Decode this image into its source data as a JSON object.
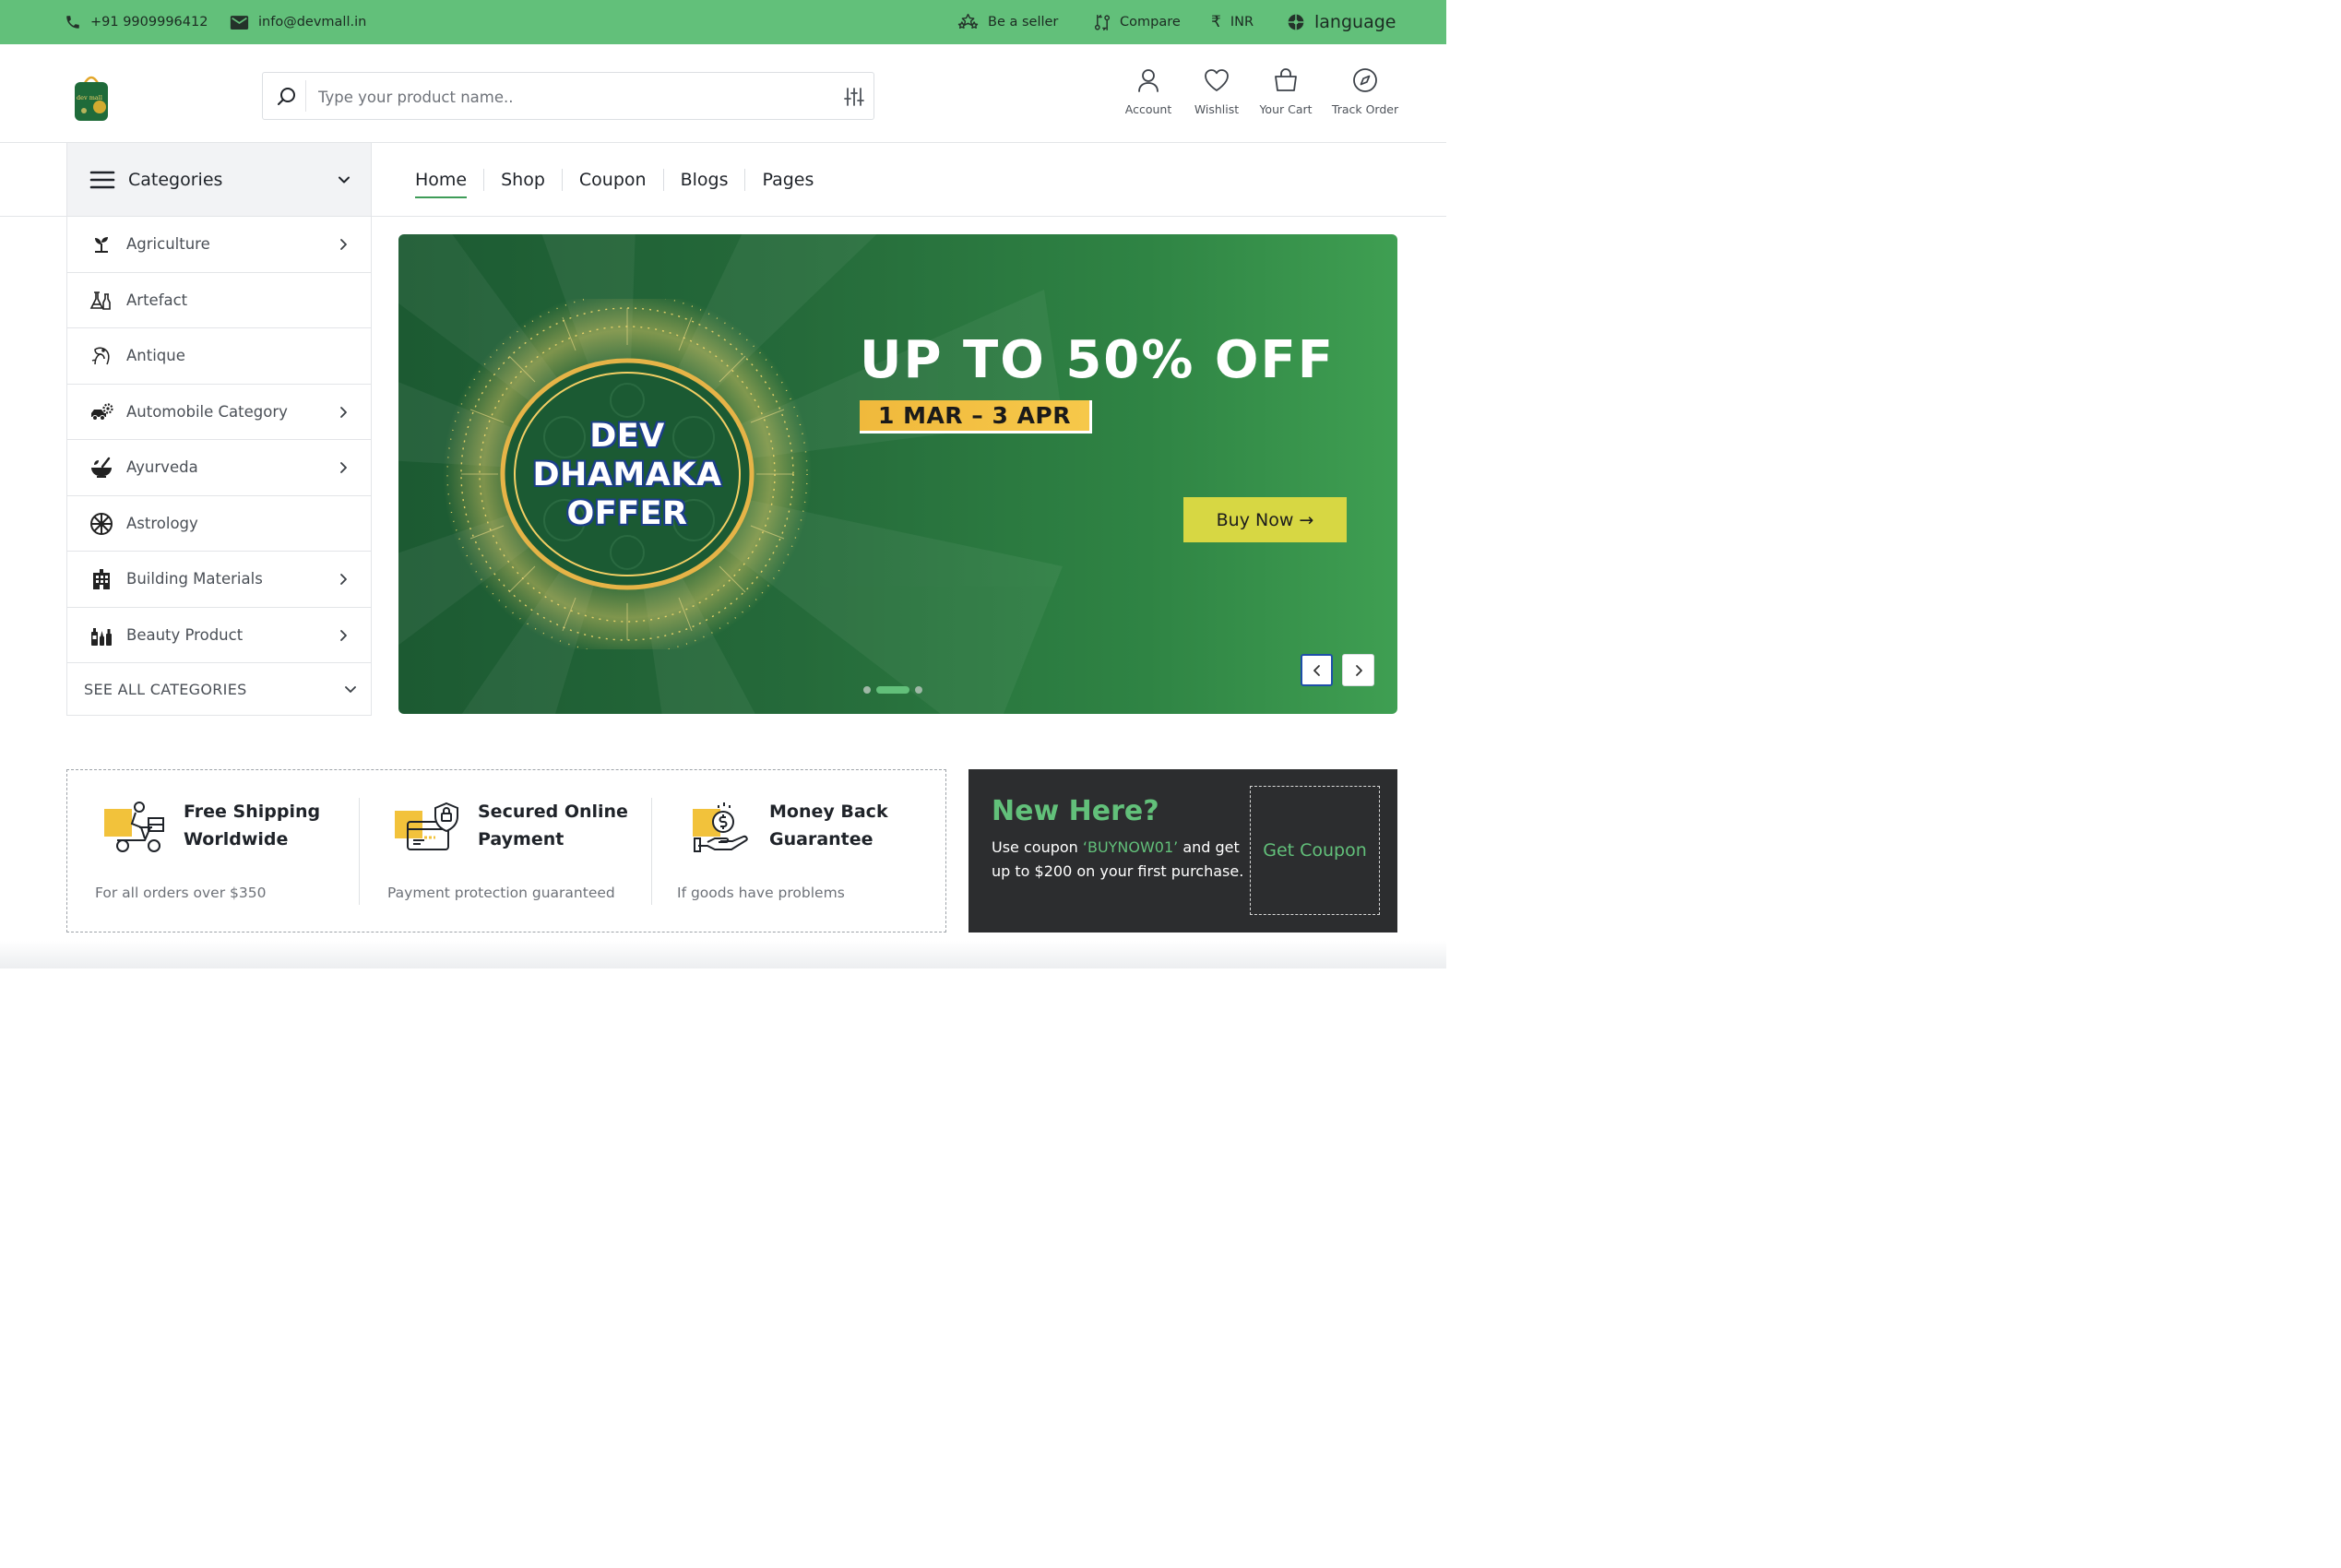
{
  "colors": {
    "brand_green": "#62c07a",
    "nav_active": "#3e9c58",
    "buy_button": "#d7d743",
    "date_badge": "#f2c145",
    "coupon_bg": "#2c2d2f"
  },
  "topbar": {
    "phone": "+91 9909996412",
    "email": "info@devmall.in",
    "seller": "Be a seller",
    "compare": "Compare",
    "currency": "INR",
    "language": "language",
    "icons": [
      "phone-icon",
      "mail-icon",
      "stars-icon",
      "compare-icon",
      "rupee-icon",
      "aperture-icon"
    ]
  },
  "header": {
    "logo_text": "dev mall",
    "search_placeholder": "Type your product name..",
    "actions": [
      {
        "label": "Account",
        "icon": "user-icon"
      },
      {
        "label": "Wishlist",
        "icon": "heart-icon"
      },
      {
        "label": "Your Cart",
        "icon": "bag-icon"
      },
      {
        "label": "Track Order",
        "icon": "compass-icon"
      }
    ]
  },
  "categories": {
    "label": "Categories",
    "items": [
      {
        "label": "Agriculture",
        "icon": "sprout-icon",
        "has_sub": true
      },
      {
        "label": "Artefact",
        "icon": "flask-icon",
        "has_sub": false
      },
      {
        "label": "Antique",
        "icon": "antique-horse-icon",
        "has_sub": false
      },
      {
        "label": "Automobile Category",
        "icon": "car-gear-icon",
        "has_sub": true
      },
      {
        "label": "Ayurveda",
        "icon": "mortar-icon",
        "has_sub": true
      },
      {
        "label": "Astrology",
        "icon": "astrology-wheel-icon",
        "has_sub": false
      },
      {
        "label": "Building Materials",
        "icon": "building-icon",
        "has_sub": true
      },
      {
        "label": "Beauty Product",
        "icon": "cosmetics-icon",
        "has_sub": true
      }
    ],
    "see_all": "SEE ALL CATEGORIES"
  },
  "nav": {
    "items": [
      "Home",
      "Shop",
      "Coupon",
      "Blogs",
      "Pages"
    ],
    "active": "Home"
  },
  "hero": {
    "offer_line1": "DEV",
    "offer_line2": "DHAMAKA",
    "offer_line3": "OFFER",
    "headline": "UP TO 50% OFF",
    "dates": "1 MAR – 3 APR",
    "button": "Buy Now →",
    "slide_count": 3,
    "active_slide": 2
  },
  "features": [
    {
      "title_line1": "Free Shipping",
      "title_line2": "Worldwide",
      "desc": "For all orders over $350",
      "icon": "delivery-scooter-icon"
    },
    {
      "title_line1": "Secured Online",
      "title_line2": "Payment",
      "desc": "Payment protection guaranteed",
      "icon": "secure-card-icon"
    },
    {
      "title_line1": "Money Back",
      "title_line2": "Guarantee",
      "desc": "If goods have problems",
      "icon": "money-back-icon"
    }
  ],
  "coupon": {
    "title": "New Here?",
    "text_before": "Use coupon ",
    "code": "‘BUYNOW01’",
    "text_after": " and get up to $200 on your first purchase.",
    "button": "Get Coupon"
  }
}
